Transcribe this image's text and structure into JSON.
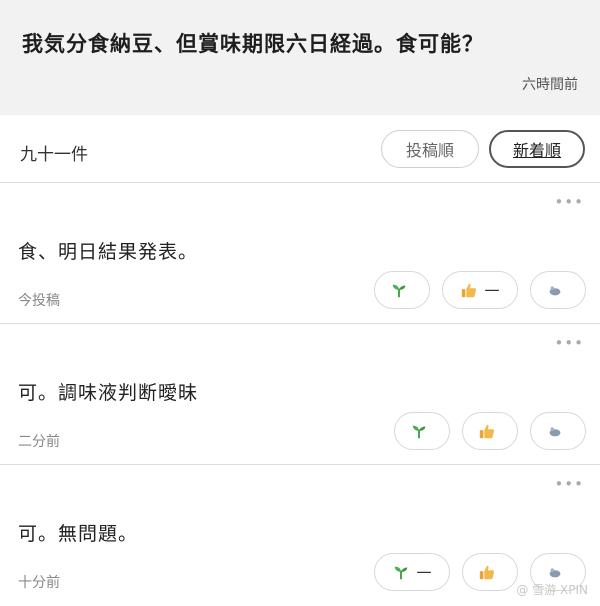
{
  "question": {
    "text": "我気分食納豆、但賞味期限六日経過。食可能？",
    "time": "六時間前"
  },
  "sort": {
    "count": "九十一件",
    "by_post": "投稿順",
    "by_new": "新着順"
  },
  "answers": [
    {
      "text": "食、明日結果発表。",
      "time": "今投稿",
      "sprout": "",
      "like": "一",
      "bad": ""
    },
    {
      "text": "可。調味液判断曖昧",
      "time": "二分前",
      "sprout": "",
      "like": "",
      "bad": ""
    },
    {
      "text": "可。無問題。",
      "time": "十分前",
      "sprout": "一",
      "like": "",
      "bad": ""
    }
  ],
  "more_icon": "more-dots-icon",
  "icons": {
    "sprout": "sprout-icon",
    "like": "thumbs-up-icon",
    "bad": "bad-icon"
  },
  "colors": {
    "sprout": "#3a9a3a",
    "like": "#e8a33a",
    "bad": "#8a9bb0"
  },
  "watermark": "@ 雪游 XPIN"
}
